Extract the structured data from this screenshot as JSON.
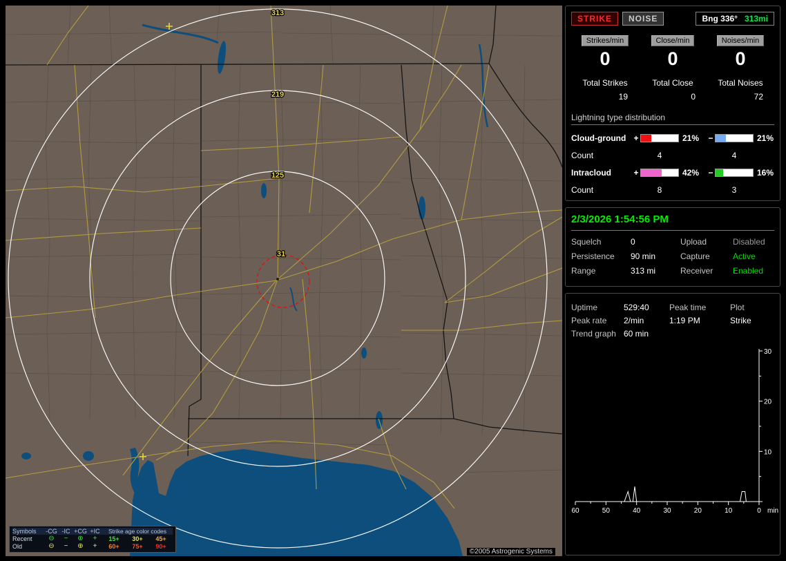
{
  "map": {
    "ring_labels": [
      "313",
      "219",
      "125",
      "31"
    ],
    "copyright": "©2005 Astrogenic Systems",
    "colors": {
      "land": "#6c5f56",
      "water": "#0e4e7c",
      "road": "#b6a040",
      "county_line": "#5a5048",
      "state_line": "#0d0d0d",
      "range_ring": "#ffffff",
      "ring_label": "#e8d44a",
      "alarm_ring": "#e01010",
      "old_strike": "#ded83e"
    },
    "legend": {
      "header_symbols": "Symbols",
      "columns": [
        "-CG",
        "-IC",
        "+CG",
        "+IC"
      ],
      "age_title": "Strike age color codes",
      "symbols": [
        "⊖",
        "−",
        "⊕",
        "+"
      ],
      "rows": [
        {
          "name": "Recent",
          "symbol_color": "#4ddb4d",
          "ages": [
            {
              "label": "15+",
              "color": "#4ddb4d"
            },
            {
              "label": "30+",
              "color": "#e6e64d"
            },
            {
              "label": "45+",
              "color": "#e6a94d"
            }
          ]
        },
        {
          "name": "Old",
          "symbol_color": "#e6e64d",
          "ages": [
            {
              "label": "60+",
              "color": "#f08030"
            },
            {
              "label": "75+",
              "color": "#f05530"
            },
            {
              "label": "90+",
              "color": "#f03030"
            }
          ]
        }
      ]
    }
  },
  "panel": {
    "indicators": {
      "strike": "STRIKE",
      "noise": "NOISE",
      "bearing_label": "Bng 336°",
      "bearing_value": "313mi"
    },
    "counters": [
      {
        "label": "Strikes/min",
        "value": "0"
      },
      {
        "label": "Close/min",
        "value": "0"
      },
      {
        "label": "Noises/min",
        "value": "0"
      }
    ],
    "totals": [
      {
        "label": "Total Strikes",
        "value": "19"
      },
      {
        "label": "Total Close",
        "value": "0"
      },
      {
        "label": "Total Noises",
        "value": "72"
      }
    ],
    "distribution": {
      "title": "Lightning type distribution",
      "rows": [
        {
          "name": "Cloud-ground",
          "plus_sign": "+",
          "minus_sign": "−",
          "plus_pct": "21%",
          "minus_pct": "21%",
          "plus_color": "#ee1111",
          "minus_color": "#77aaee",
          "plus_width": 28,
          "minus_width": 28,
          "count_label": "Count",
          "plus_count": "4",
          "minus_count": "4"
        },
        {
          "name": "Intracloud",
          "plus_sign": "+",
          "minus_sign": "−",
          "plus_pct": "42%",
          "minus_pct": "16%",
          "plus_color": "#ee66cc",
          "minus_color": "#22cc22",
          "plus_width": 56,
          "minus_width": 21,
          "count_label": "Count",
          "plus_count": "8",
          "minus_count": "3"
        }
      ]
    },
    "status": {
      "datetime": "2/3/2026 1:54:56 PM",
      "rows": [
        {
          "l1": "Squelch",
          "v1": "0",
          "l2": "Upload",
          "v2": "Disabled",
          "v2_color": "#9a9a9a"
        },
        {
          "l1": "Persistence",
          "v1": "90 min",
          "l2": "Capture",
          "v2": "Active",
          "v2_color": "#00dd00"
        },
        {
          "l1": "Range",
          "v1": "313 mi",
          "l2": "Receiver",
          "v2": "Enabled",
          "v2_color": "#00dd00"
        }
      ]
    },
    "stats": {
      "uptime_label": "Uptime",
      "uptime_value": "529:40",
      "peak_time_label": "Peak time",
      "plot_label": "Plot",
      "peak_rate_label": "Peak rate",
      "peak_rate_value": "2/min",
      "peak_time_value": "1:19 PM",
      "plot_value": "Strike",
      "trend_label": "Trend graph",
      "trend_value": "60 min"
    }
  },
  "chart_data": {
    "type": "line",
    "title": "Trend graph (60 min)",
    "xlabel": "min",
    "x_unit": "min",
    "x_ticks": [
      "60",
      "50",
      "40",
      "30",
      "20",
      "10",
      "0"
    ],
    "y_ticks": [
      "30",
      "20",
      "10"
    ],
    "xlim": [
      60,
      0
    ],
    "ylim": [
      0,
      30
    ],
    "grid": false,
    "axis_position": {
      "y_axis": "right",
      "x_axis": "bottom"
    },
    "series": [
      {
        "name": "Strikes per minute",
        "points": [
          [
            60,
            0
          ],
          [
            44,
            0
          ],
          [
            42.8,
            2
          ],
          [
            42,
            0
          ],
          [
            41.2,
            0
          ],
          [
            40.6,
            3
          ],
          [
            40,
            0
          ],
          [
            30,
            0
          ],
          [
            20,
            0
          ],
          [
            6.2,
            0
          ],
          [
            5.6,
            2
          ],
          [
            4.6,
            2
          ],
          [
            4.2,
            0
          ],
          [
            0,
            0
          ]
        ]
      }
    ]
  }
}
